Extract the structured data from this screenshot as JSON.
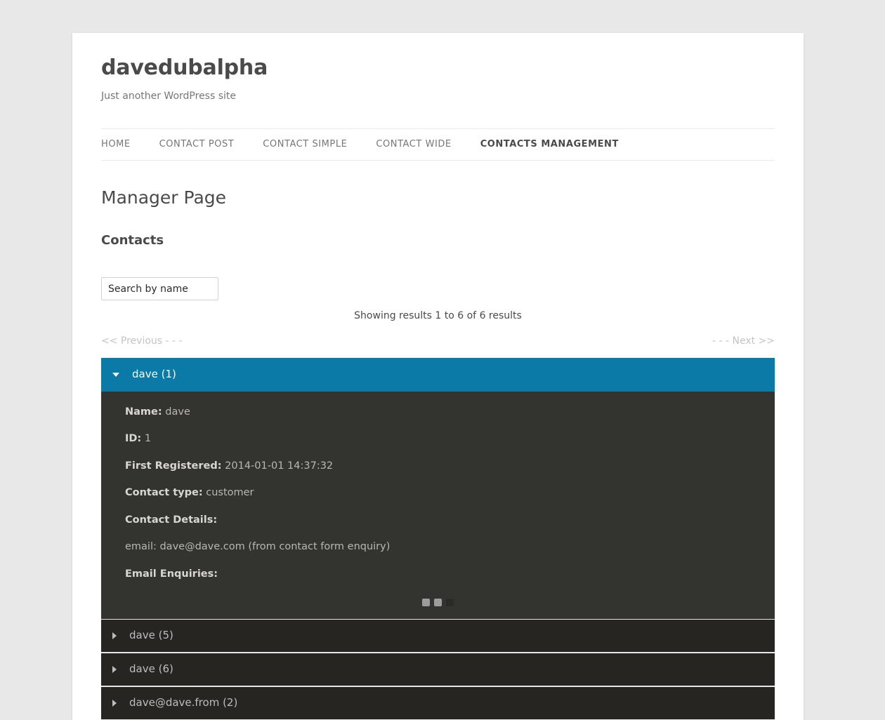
{
  "site": {
    "title": "davedubalpha",
    "tagline": "Just another WordPress site"
  },
  "nav": {
    "items": [
      {
        "label": "HOME",
        "active": false
      },
      {
        "label": "CONTACT POST",
        "active": false
      },
      {
        "label": "CONTACT SIMPLE",
        "active": false
      },
      {
        "label": "CONTACT WIDE",
        "active": false
      },
      {
        "label": "CONTACTS MANAGEMENT",
        "active": true
      }
    ]
  },
  "content": {
    "page_title": "Manager Page",
    "section_heading": "Contacts"
  },
  "search": {
    "placeholder": "Search by name",
    "value": ""
  },
  "results": {
    "info": "Showing results 1 to 6 of 6 results",
    "prev_label": "<< Previous - - -",
    "next_label": "- - - Next >>"
  },
  "colors": {
    "accent_blue": "#0b7aa6",
    "panel_dark": "#333330",
    "row_dark": "#262522",
    "page_bg": "#e8e8e8"
  },
  "accordion": {
    "items": [
      {
        "label": "dave (1)",
        "open": true,
        "icon": "caret-down-icon",
        "details": [
          {
            "label": "Name:",
            "value": "dave"
          },
          {
            "label": "ID:",
            "value": "1"
          },
          {
            "label": "First Registered:",
            "value": "2014-01-01 14:37:32"
          },
          {
            "label": "Contact type:",
            "value": "customer"
          },
          {
            "label": "Contact Details:",
            "value": ""
          },
          {
            "label": "",
            "value": "email: dave@dave.com (from contact form enquiry)"
          },
          {
            "label": "Email Enquiries:",
            "value": ""
          }
        ],
        "loader": {
          "states": [
            "on",
            "on",
            "off"
          ]
        }
      },
      {
        "label": "dave (5)",
        "open": false,
        "icon": "caret-right-icon",
        "details": [],
        "loader": null
      },
      {
        "label": "dave (6)",
        "open": false,
        "icon": "caret-right-icon",
        "details": [],
        "loader": null
      },
      {
        "label": "dave@dave.from (2)",
        "open": false,
        "icon": "caret-right-icon",
        "details": [],
        "loader": null
      }
    ]
  }
}
